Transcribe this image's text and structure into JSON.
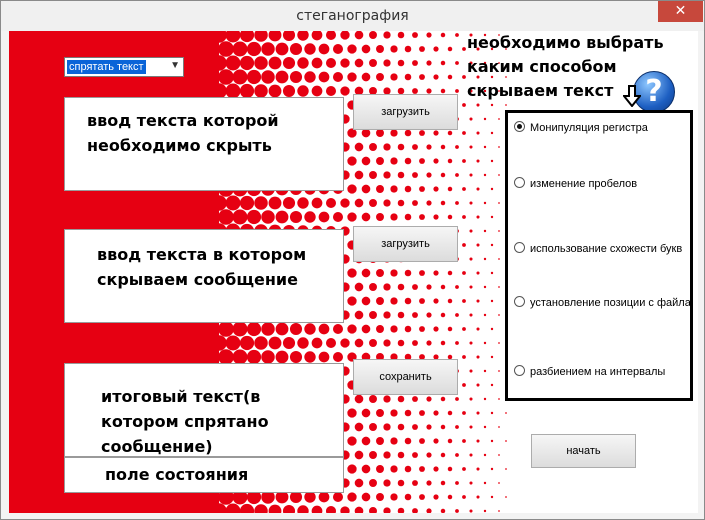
{
  "window": {
    "title": "стеганография",
    "close_glyph": "✕"
  },
  "mode_select": {
    "value": "спрятать текст"
  },
  "fields": {
    "input_hide": "ввод текста которой необходимо скрыть",
    "input_cover": "ввод текста в котором скрываем сообщение",
    "output": "итоговый текст(в котором спрятано сообщение)",
    "status": "поле состояния"
  },
  "buttons": {
    "load1": "загрузить",
    "load2": "загрузить",
    "save": "сохранить",
    "start": "начать"
  },
  "hint": {
    "text": "необходимо выбрать каким способом скрываем текст"
  },
  "help_icon": {
    "glyph": "?"
  },
  "methods": [
    {
      "label": "Монипуляция регистра",
      "checked": true
    },
    {
      "label": "изменение пробелов",
      "checked": false
    },
    {
      "label": "использование схожести букв",
      "checked": false
    },
    {
      "label": "установление позиции с файла",
      "checked": false
    },
    {
      "label": "разбиением на интервалы",
      "checked": false
    }
  ],
  "colors": {
    "background_red": "#e60012",
    "accent_blue": "#0a64d8"
  }
}
